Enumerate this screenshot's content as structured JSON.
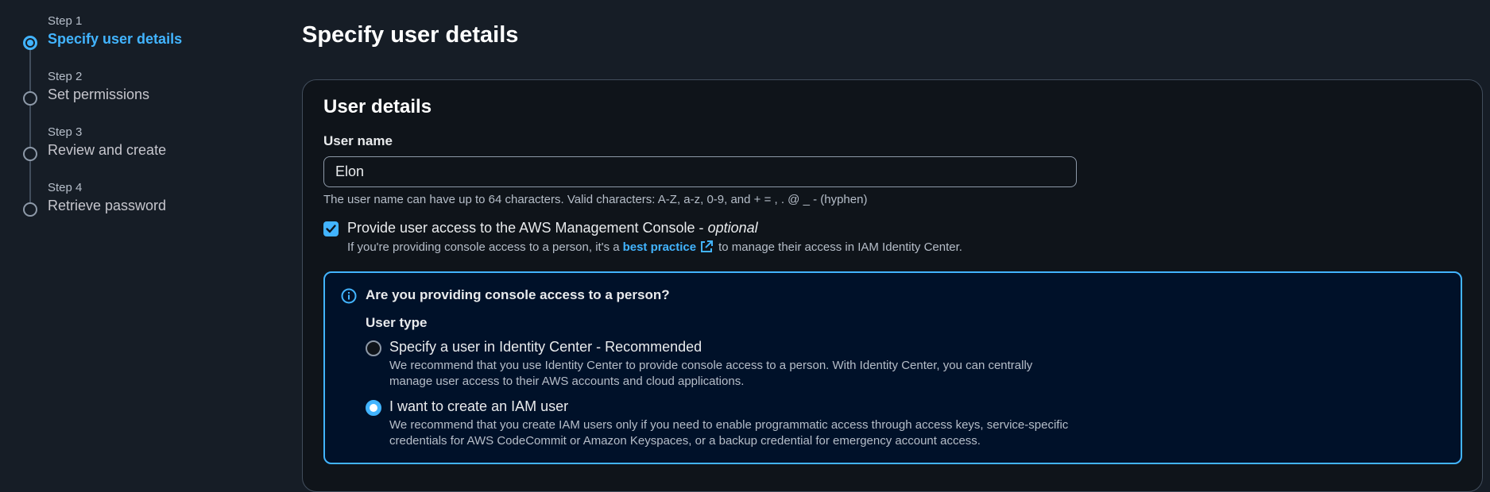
{
  "steps": [
    {
      "number": "Step 1",
      "label": "Specify user details",
      "active": true
    },
    {
      "number": "Step 2",
      "label": "Set permissions",
      "active": false
    },
    {
      "number": "Step 3",
      "label": "Review and create",
      "active": false
    },
    {
      "number": "Step 4",
      "label": "Retrieve password",
      "active": false
    }
  ],
  "page": {
    "title": "Specify user details"
  },
  "user_details": {
    "title": "User details",
    "user_name_label": "User name",
    "user_name_value": "Elon",
    "user_name_hint": "The user name can have up to 64 characters. Valid characters: A-Z, a-z, 0-9, and + = , . @ _ - (hyphen)",
    "console_access": {
      "checked": true,
      "label": "Provide user access to the AWS Management Console -",
      "optional": "optional",
      "desc_before": "If you're providing console access to a person, it's a",
      "link": "best practice",
      "desc_after": "to manage their access in IAM Identity Center."
    }
  },
  "info_box": {
    "title": "Are you providing console access to a person?",
    "user_type_label": "User type",
    "options": [
      {
        "label": "Specify a user in Identity Center - Recommended",
        "description": "We recommend that you use Identity Center to provide console access to a person. With Identity Center, you can centrally manage user access to their AWS accounts and cloud applications.",
        "selected": false
      },
      {
        "label": "I want to create an IAM user",
        "description": "We recommend that you create IAM users only if you need to enable programmatic access through access keys, service-specific credentials for AWS CodeCommit or Amazon Keyspaces, or a backup credential for emergency account access.",
        "selected": true
      }
    ]
  },
  "colors": {
    "accent": "#42b4ff",
    "background": "#161d26",
    "panel": "#0f141a",
    "info_background": "#001129"
  },
  "icons": {
    "checkbox": "check-icon",
    "external_link": "external-link-icon",
    "info": "info-icon"
  }
}
